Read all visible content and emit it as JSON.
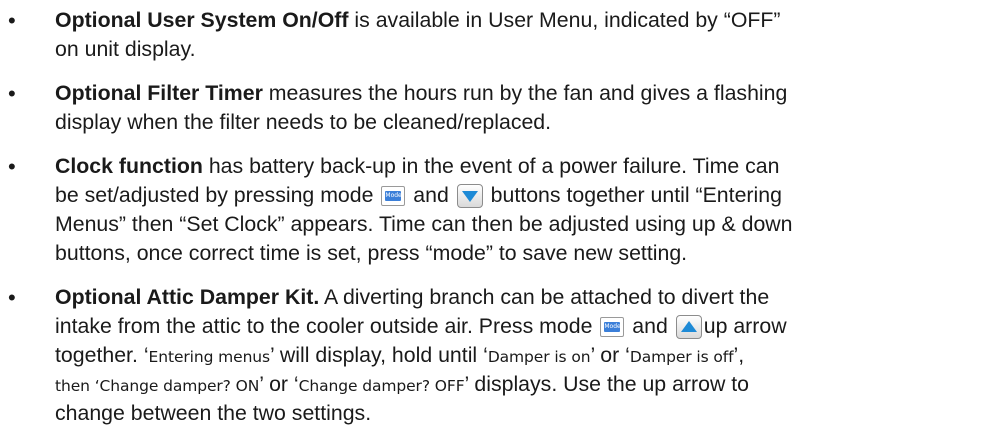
{
  "bullet_char": "•",
  "icons": {
    "mode_label": "Mode",
    "down_arrow": "down-arrow-button",
    "up_arrow": "up-arrow-button"
  },
  "items": [
    {
      "title": "Optional User System On/Off",
      "line1": " is available in User Menu, indicated by “OFF”",
      "line2": "on unit display."
    },
    {
      "title": "Optional Filter Timer",
      "line1": " measures the hours run by the fan and gives a flashing",
      "line2": "display when the filter needs to be cleaned/replaced."
    },
    {
      "title": "Clock function",
      "line1": " has battery back-up in the event of a power failure. Time can",
      "line2a": "be set/adjusted by pressing mode ",
      "line2b": " and ",
      "line2c": " buttons together until “Entering",
      "line3": "Menus” then “Set Clock” appears.  Time can then be adjusted using up & down",
      "line4": "buttons, once correct time is set, press “mode” to save new setting."
    },
    {
      "title": "Optional Attic Damper Kit.",
      "line1": "  A diverting branch can be attached to divert the",
      "line2": "intake from the attic to the cooler outside air. Press mode ",
      "line2b": " and ",
      "line2c": "up arrow",
      "line3": "together. ",
      "line3_q1": "‘",
      "line3_s1": "Entering menus",
      "line3_b": "’ will display, hold until ",
      "line3_q2": "‘",
      "line3_s2": "Damper is on",
      "line3_c": "’ or ",
      "line3_q3": "‘",
      "line3_s3": "Damper is off",
      "line3_d": "’,",
      "line4_s1": "then ‘Change damper? ON",
      "line4_a": "’ or ‘",
      "line4_s2": "Change damper? OFF",
      "line4_b": "’ displays.  Use the up arrow to",
      "line5": "change between the two settings."
    }
  ]
}
